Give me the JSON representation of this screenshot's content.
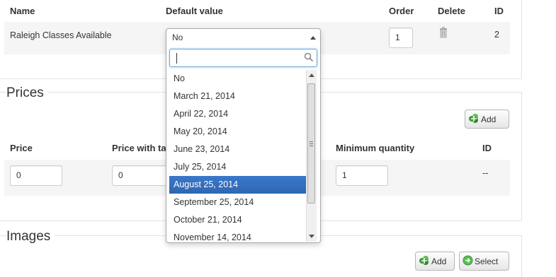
{
  "fields_table": {
    "headers": {
      "name": "Name",
      "default_value": "Default value",
      "order": "Order",
      "delete": "Delete",
      "id": "ID"
    },
    "row": {
      "name": "Raleigh Classes Available",
      "order": "1",
      "id": "2"
    }
  },
  "default_value_select": {
    "selected": "No",
    "search_value": "",
    "options": [
      "No",
      "March 21, 2014",
      "April 22, 2014",
      "May 20, 2014",
      "June 23, 2014",
      "July 25, 2014",
      "August 25, 2014",
      "September 25, 2014",
      "October 21, 2014",
      "November 14, 2014"
    ],
    "highlighted_option": "August 25, 2014"
  },
  "prices": {
    "legend": "Prices",
    "add_label": "Add",
    "headers": {
      "price": "Price",
      "price_with_tax": "Price with ta",
      "minimum_quantity": "Minimum quantity",
      "id": "ID"
    },
    "row": {
      "price": "0",
      "price_with_tax": "0",
      "minimum_quantity": "1",
      "id": "--"
    }
  },
  "images": {
    "legend": "Images",
    "add_label": "Add",
    "select_label": "Select"
  },
  "colors": {
    "highlight": "#3b78c9",
    "add_icon": "#4caf50"
  }
}
